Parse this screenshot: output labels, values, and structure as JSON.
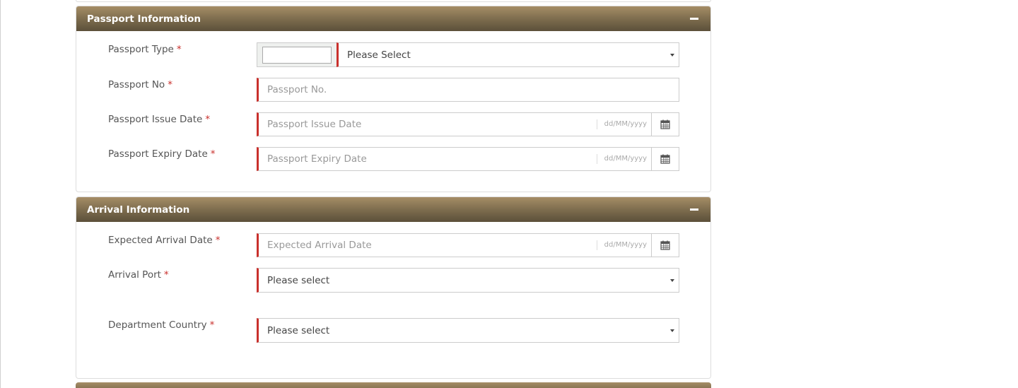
{
  "passport_panel": {
    "title": "Passport Information",
    "fields": {
      "passport_type": {
        "label": "Passport Type",
        "select_value": "Please Select"
      },
      "passport_no": {
        "label": "Passport No",
        "placeholder": "Passport No."
      },
      "issue_date": {
        "label": "Passport Issue Date",
        "placeholder": "Passport Issue Date",
        "format_hint": "dd/MM/yyyy"
      },
      "expiry_date": {
        "label": "Passport Expiry Date",
        "placeholder": "Passport Expiry Date",
        "format_hint": "dd/MM/yyyy"
      }
    }
  },
  "arrival_panel": {
    "title": "Arrival Information",
    "fields": {
      "arrival_date": {
        "label": "Expected Arrival Date",
        "placeholder": "Expected Arrival Date",
        "format_hint": "dd/MM/yyyy"
      },
      "arrival_port": {
        "label": "Arrival Port",
        "select_value": "Please select"
      },
      "department_country": {
        "label": "Department Country",
        "select_value": "Please select"
      }
    }
  },
  "required_marker": "*",
  "colors": {
    "header": "#7a6a4c",
    "required": "#c9302c"
  },
  "icons": {
    "collapse": "minus-icon",
    "calendar": "calendar-icon",
    "dropdown": "caret-down-icon"
  }
}
